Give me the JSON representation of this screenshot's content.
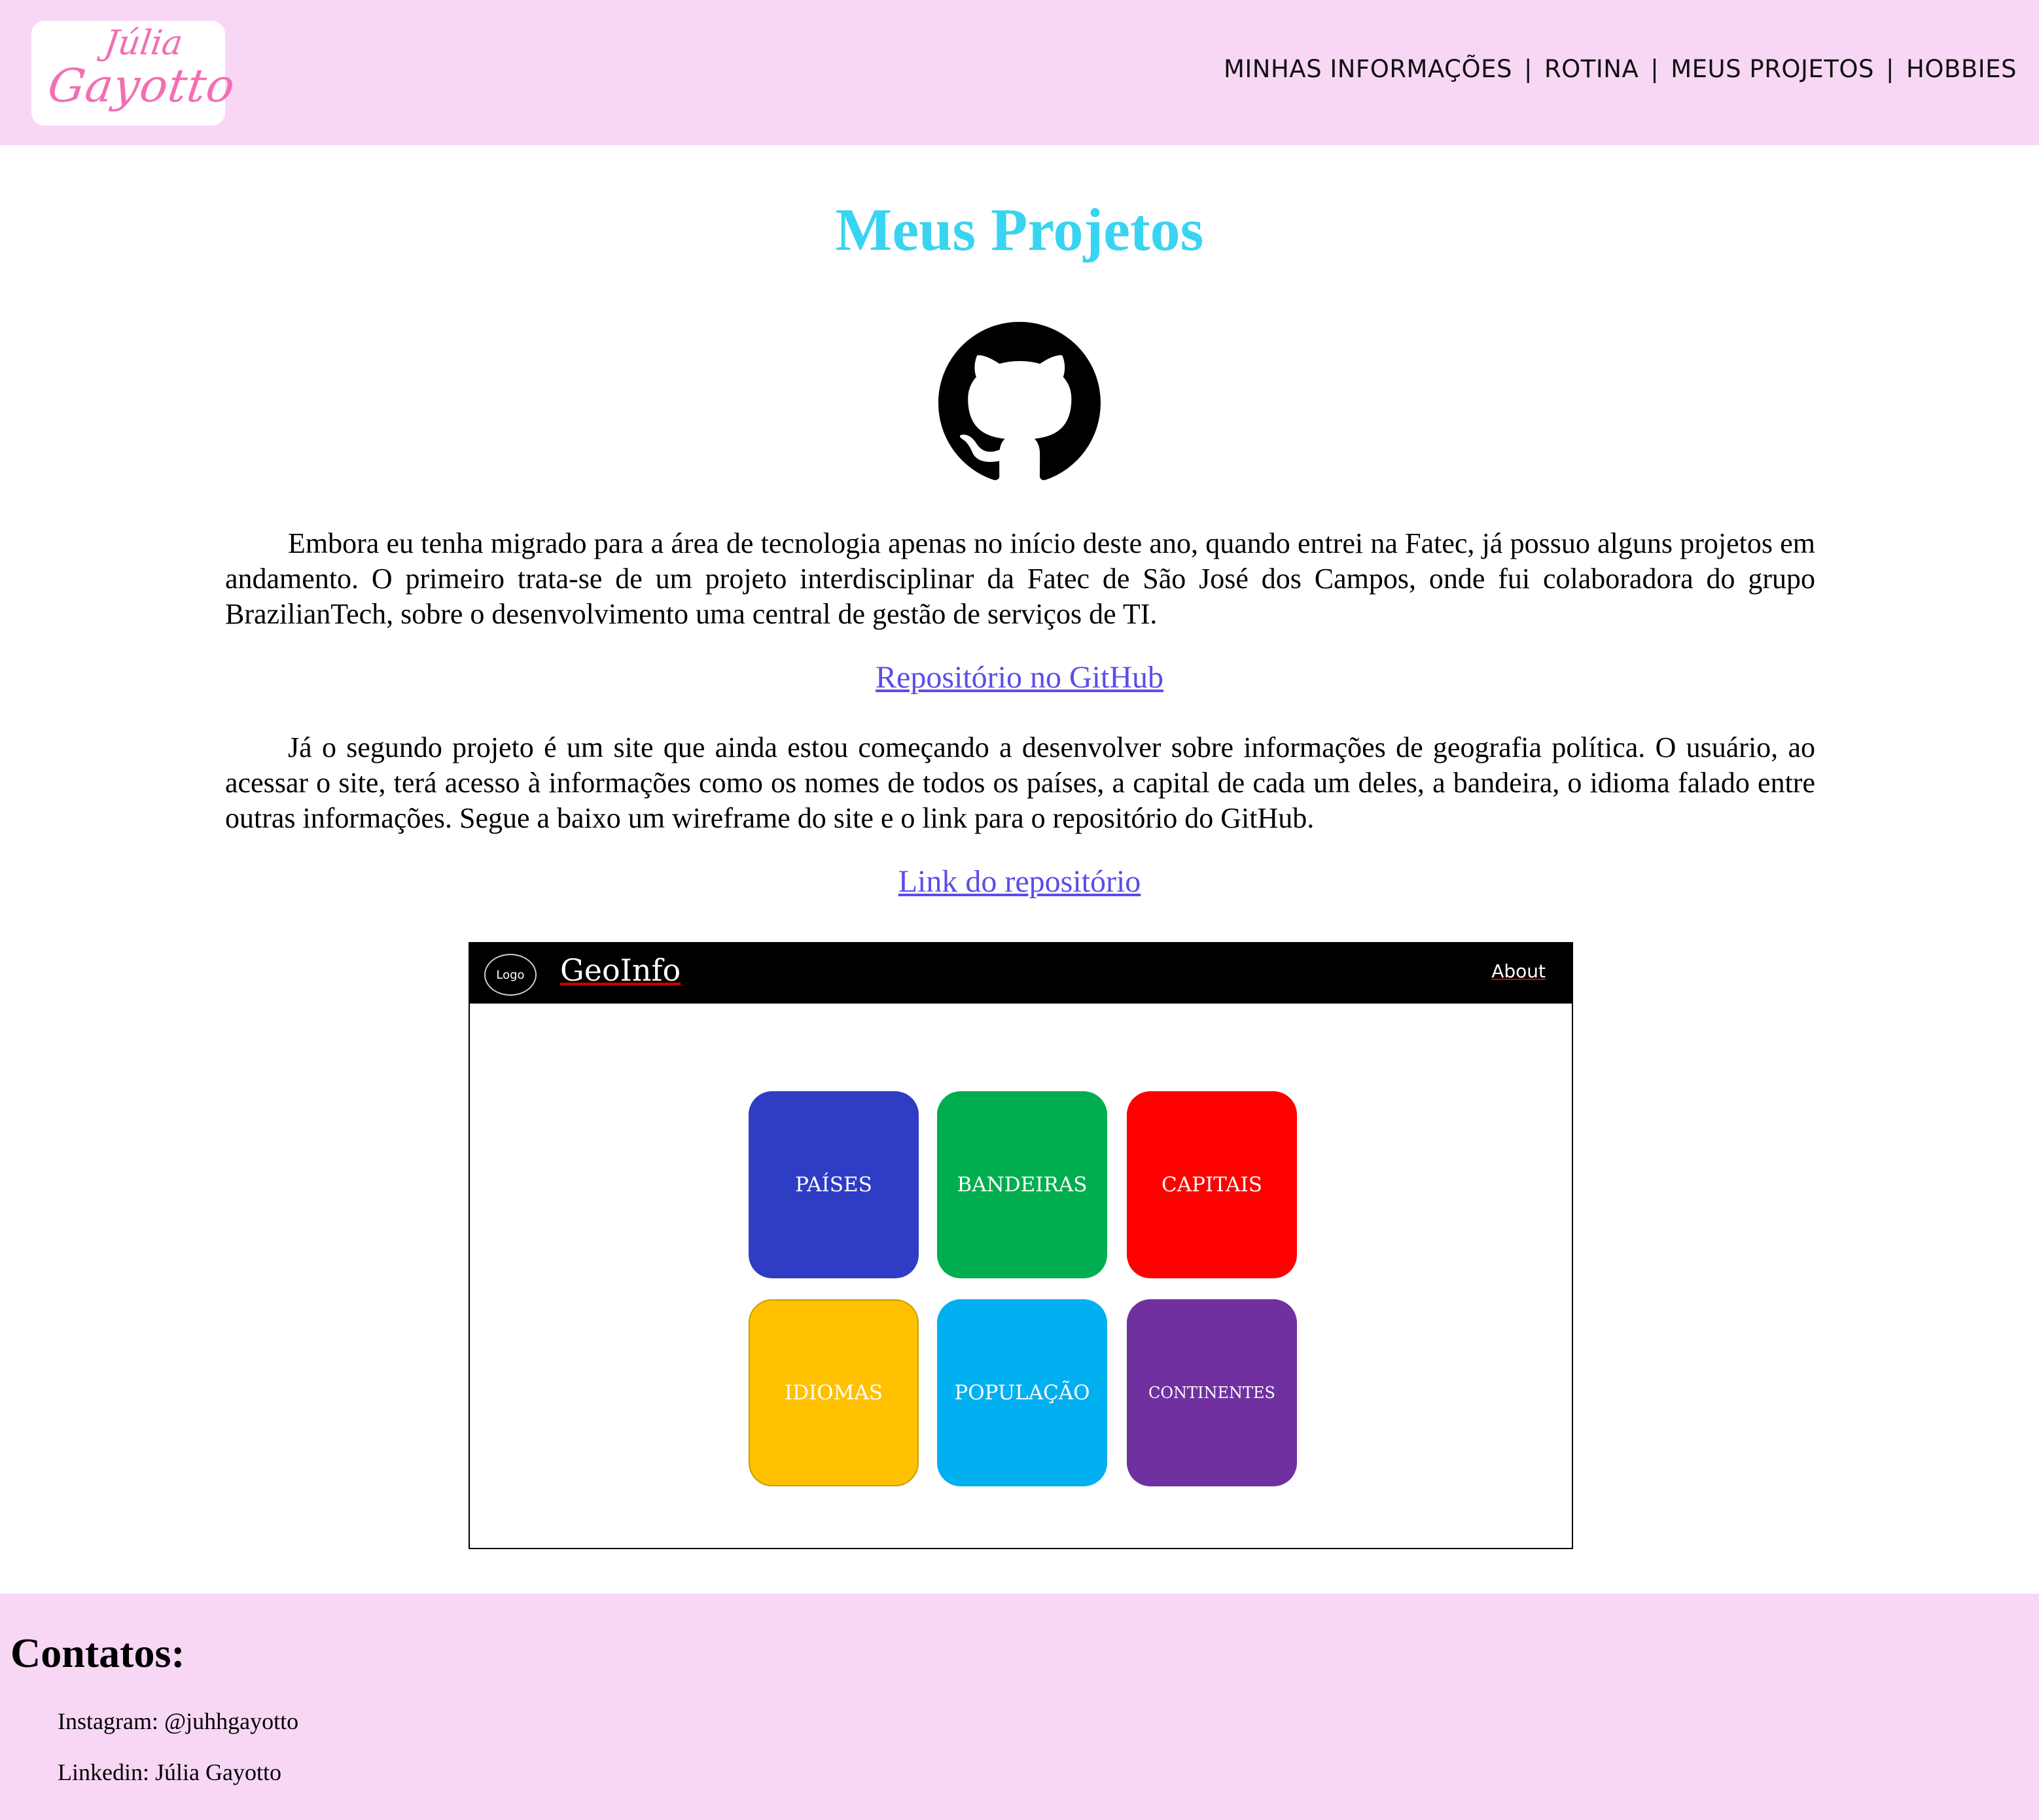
{
  "header": {
    "logo": {
      "line1": "Júlia",
      "line2": "Gayotto"
    },
    "nav": [
      {
        "label": "MINHAS INFORMAÇÕES"
      },
      {
        "label": "ROTINA"
      },
      {
        "label": "MEUS PROJETOS"
      },
      {
        "label": "HOBBIES"
      }
    ],
    "separator": "|"
  },
  "main": {
    "title": "Meus Projetos",
    "paragraph1": "Embora eu tenha migrado para a área de tecnologia apenas no início deste ano, quando entrei na Fatec, já possuo alguns projetos em andamento. O primeiro trata-se de um projeto interdisciplinar da Fatec de São José dos Campos, onde fui colaboradora do grupo BrazilianTech, sobre o desenvolvimento uma central de gestão de serviços de TI.",
    "link1": "Repositório no GitHub",
    "paragraph2": "Já o segundo projeto é um site que ainda estou começando a desenvolver sobre informações de geografia política. O usuário, ao acessar o site, terá acesso à informações como os nomes de todos os países, a capital de cada um deles, a bandeira, o idioma falado entre outras informações. Segue a baixo um wireframe do site e o link para o repositório do GitHub.",
    "link2": "Link do repositório",
    "icon": "github-icon"
  },
  "wireframe": {
    "logo": "Logo",
    "title": "GeoInfo",
    "about": "About",
    "tiles": [
      "PAÍSES",
      "BANDEIRAS",
      "CAPITAIS",
      "IDIOMAS",
      "POPULAÇÃO",
      "CONTINENTES"
    ],
    "tile_colors": [
      "#2f3cc4",
      "#00ad4f",
      "#ff0000",
      "#ffc000",
      "#00b0f0",
      "#7030a0"
    ]
  },
  "footer": {
    "title": "Contatos:",
    "contacts": [
      "Instagram: @juhhgayotto",
      "Linkedin: Júlia Gayotto"
    ]
  },
  "colors": {
    "header_bg": "#f8d7f5",
    "title": "#38d4f1",
    "link": "#5b4de8",
    "logo_pink": "#f26fb3"
  }
}
